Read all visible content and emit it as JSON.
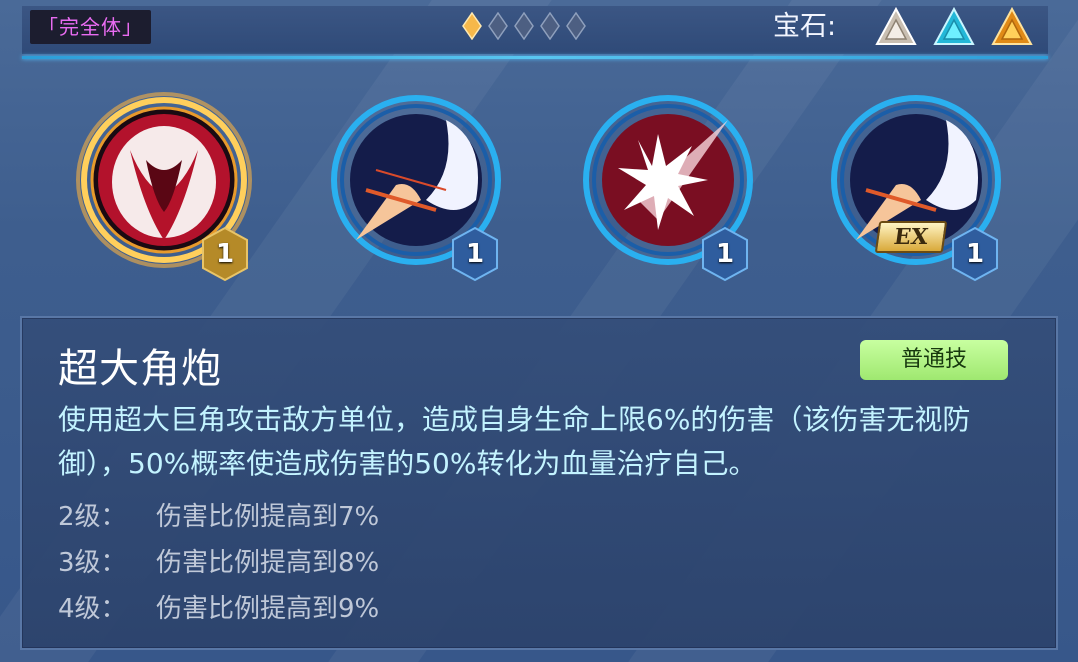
{
  "header": {
    "form_label": "「完全体」",
    "stars": {
      "filled": 1,
      "total": 5,
      "filled_color": "#f6b84a",
      "empty_color": "#5d7096"
    },
    "gem_label": "宝石:",
    "gems": [
      {
        "name": "white-gem-icon",
        "color": "#e8e0d4"
      },
      {
        "name": "cyan-gem-icon",
        "color": "#3fd8f2"
      },
      {
        "name": "gold-gem-icon",
        "color": "#f5a82a"
      }
    ]
  },
  "skills": [
    {
      "icon": "horn-skill-icon",
      "level": "1",
      "selected": true
    },
    {
      "icon": "slash-skill-icon",
      "level": "1",
      "selected": false
    },
    {
      "icon": "burst-skill-icon",
      "level": "1",
      "selected": false
    },
    {
      "icon": "ex-slash-skill-icon",
      "level": "1",
      "selected": false,
      "badge": "EX"
    }
  ],
  "detail": {
    "name": "超大角炮",
    "type_tag": "普通技",
    "description": "使用超大巨角攻击敌方单位，造成自身生命上限6%的伤害（该伤害无视防御），50%概率使造成伤害的50%转化为血量治疗自己。",
    "levels": [
      {
        "label": "2级：",
        "text": "伤害比例提高到7%"
      },
      {
        "label": "3级：",
        "text": "伤害比例提高到8%"
      },
      {
        "label": "4级：",
        "text": "伤害比例提高到9%"
      }
    ]
  }
}
